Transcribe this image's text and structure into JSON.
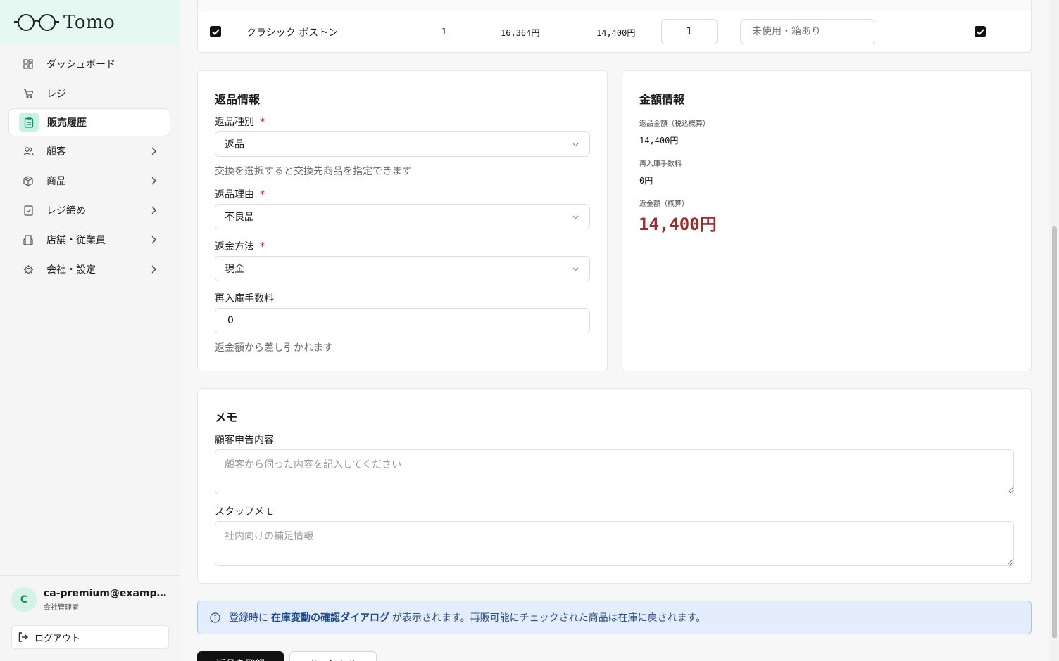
{
  "brand": {
    "name": "Tomo",
    "accent": "#e6f8f2"
  },
  "sidebar": {
    "items": [
      {
        "label": "ダッシュボード",
        "icon": "dashboard-icon",
        "active": false,
        "expandable": false
      },
      {
        "label": "レジ",
        "icon": "cart-icon",
        "active": false,
        "expandable": false
      },
      {
        "label": "販売履歴",
        "icon": "clipboard-icon",
        "active": true,
        "expandable": false
      },
      {
        "label": "顧客",
        "icon": "users-icon",
        "active": false,
        "expandable": true
      },
      {
        "label": "商品",
        "icon": "box-icon",
        "active": false,
        "expandable": true
      },
      {
        "label": "レジ締め",
        "icon": "receipt-icon",
        "active": false,
        "expandable": true
      },
      {
        "label": "店舗・従業員",
        "icon": "building-icon",
        "active": false,
        "expandable": true
      },
      {
        "label": "会社・設定",
        "icon": "gear-icon",
        "active": false,
        "expandable": true
      }
    ],
    "user": {
      "initial": "C",
      "email": "ca-premium@example.com",
      "role": "会社管理者"
    },
    "logout_label": "ログアウト"
  },
  "item_row": {
    "name": "クラシック ボストン",
    "quantity": "1",
    "unit_price": "16,364円",
    "price_with_tax": "14,400円",
    "return_quantity": "1",
    "condition_placeholder": "未使用・箱あり",
    "selected": true,
    "resellable": true
  },
  "return_info": {
    "title": "返品情報",
    "type_label": "返品種別",
    "type_value": "返品",
    "type_hint": "交換を選択すると交換先商品を指定できます",
    "reason_label": "返品理由",
    "reason_value": "不良品",
    "method_label": "返金方法",
    "method_value": "現金",
    "fee_label": "再入庫手数料",
    "fee_value": "0",
    "fee_hint": "返金額から差し引かれます",
    "required_mark": "*"
  },
  "amount_info": {
    "title": "金額情報",
    "return_amount_label": "返品金額（税込概算）",
    "return_amount_value": "14,400円",
    "restock_fee_label": "再入庫手数料",
    "restock_fee_value": "0円",
    "refund_label": "返金額（概算）",
    "refund_value": "14,400円",
    "refund_color": "#a12a2a"
  },
  "memo": {
    "title": "メモ",
    "customer_label": "顧客申告内容",
    "customer_placeholder": "顧客から伺った内容を記入してください",
    "staff_label": "スタッフメモ",
    "staff_placeholder": "社内向けの補足情報"
  },
  "notice": {
    "prefix": "登録時に",
    "strong": "在庫変動の確認ダイアログ",
    "suffix": "が表示されます。再販可能にチェックされた商品は在庫に戻されます。"
  },
  "actions": {
    "submit_label": "返品を登録",
    "cancel_label": "キャンセル"
  }
}
